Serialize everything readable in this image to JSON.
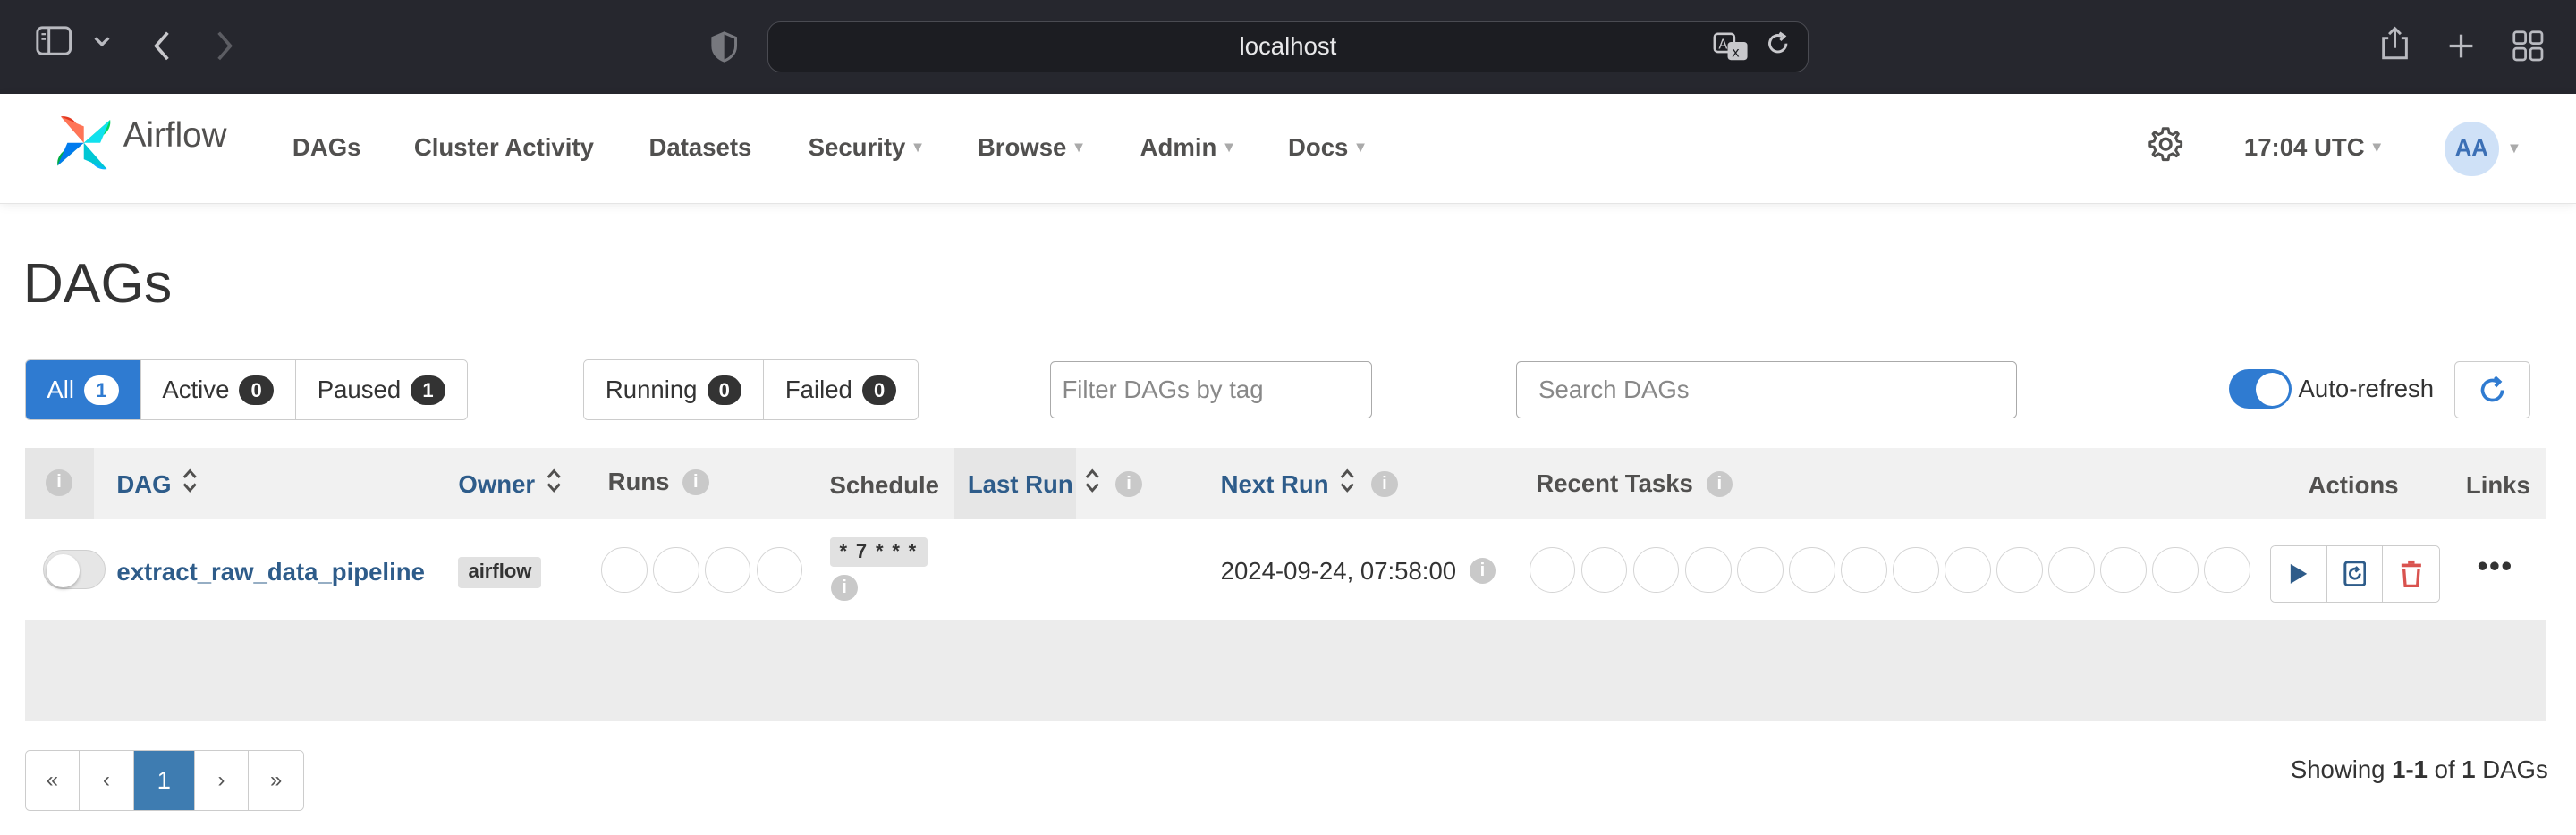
{
  "browser": {
    "url": "localhost"
  },
  "navbar": {
    "brand": "Airflow",
    "items": [
      {
        "label": "DAGs",
        "dropdown": false
      },
      {
        "label": "Cluster Activity",
        "dropdown": false
      },
      {
        "label": "Datasets",
        "dropdown": false
      },
      {
        "label": "Security",
        "dropdown": true
      },
      {
        "label": "Browse",
        "dropdown": true
      },
      {
        "label": "Admin",
        "dropdown": true
      },
      {
        "label": "Docs",
        "dropdown": true
      }
    ],
    "clock": "17:04 UTC",
    "user_initials": "AA"
  },
  "page": {
    "title": "DAGs"
  },
  "filters": {
    "status": [
      {
        "label": "All",
        "count": "1",
        "active": true
      },
      {
        "label": "Active",
        "count": "0",
        "active": false
      },
      {
        "label": "Paused",
        "count": "1",
        "active": false
      }
    ],
    "run_state": [
      {
        "label": "Running",
        "count": "0"
      },
      {
        "label": "Failed",
        "count": "0"
      }
    ],
    "tag_placeholder": "Filter DAGs by tag",
    "search_placeholder": "Search DAGs",
    "autorefresh_label": "Auto-refresh",
    "autorefresh_on": true
  },
  "table": {
    "headers": {
      "dag": "DAG",
      "owner": "Owner",
      "runs": "Runs",
      "schedule": "Schedule",
      "last_run": "Last Run",
      "next_run": "Next Run",
      "recent_tasks": "Recent Tasks",
      "actions": "Actions",
      "links": "Links"
    },
    "rows": [
      {
        "paused": true,
        "dag_id": "extract_raw_data_pipeline",
        "owner": "airflow",
        "schedule": "* 7 * * *",
        "last_run": "",
        "next_run": "2024-09-24, 07:58:00",
        "run_circles": 4,
        "task_circles": 14
      }
    ]
  },
  "pagination": {
    "first": "«",
    "prev": "‹",
    "current": "1",
    "next": "›",
    "last": "»"
  },
  "footer": {
    "showing_prefix": "Showing ",
    "range": "1-1",
    "of": " of ",
    "total": "1",
    "suffix": " DAGs"
  },
  "colors": {
    "primary": "#2f7bd1",
    "link": "#2e5c8a",
    "danger": "#d9534f",
    "browser_bar": "#26272e"
  }
}
